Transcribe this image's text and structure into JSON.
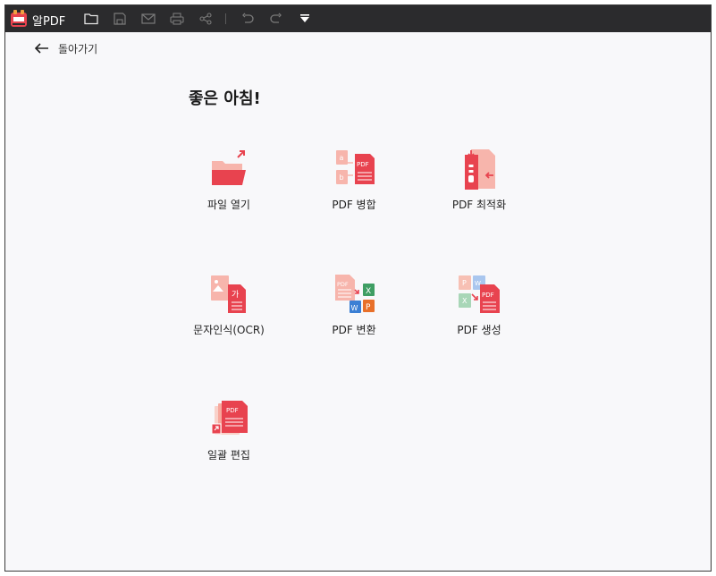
{
  "app": {
    "title": "알PDF"
  },
  "toolbar": {
    "buttons": [
      {
        "name": "open-folder-icon"
      },
      {
        "name": "save-icon"
      },
      {
        "name": "mail-icon"
      },
      {
        "name": "print-icon"
      },
      {
        "name": "share-icon"
      },
      {
        "name": "undo-icon"
      },
      {
        "name": "redo-icon"
      },
      {
        "name": "dropdown-menu-icon"
      }
    ]
  },
  "nav": {
    "back_label": "돌아가기"
  },
  "main": {
    "greeting": "좋은 아침!",
    "tiles": [
      {
        "label": "파일 열기",
        "icon": "open-folder-icon"
      },
      {
        "label": "PDF 병합",
        "icon": "merge-pdf-icon"
      },
      {
        "label": "PDF 최적화",
        "icon": "compress-pdf-icon"
      },
      {
        "label": "문자인식(OCR)",
        "icon": "ocr-icon"
      },
      {
        "label": "PDF 변환",
        "icon": "convert-pdf-icon"
      },
      {
        "label": "PDF 생성",
        "icon": "create-pdf-icon"
      },
      {
        "label": "일괄 편집",
        "icon": "batch-edit-icon"
      }
    ]
  },
  "colors": {
    "titlebar": "#2b2b2d",
    "accent": "#e8434f",
    "accent_light": "#f7b5ac",
    "background": "#f8f8fa"
  }
}
